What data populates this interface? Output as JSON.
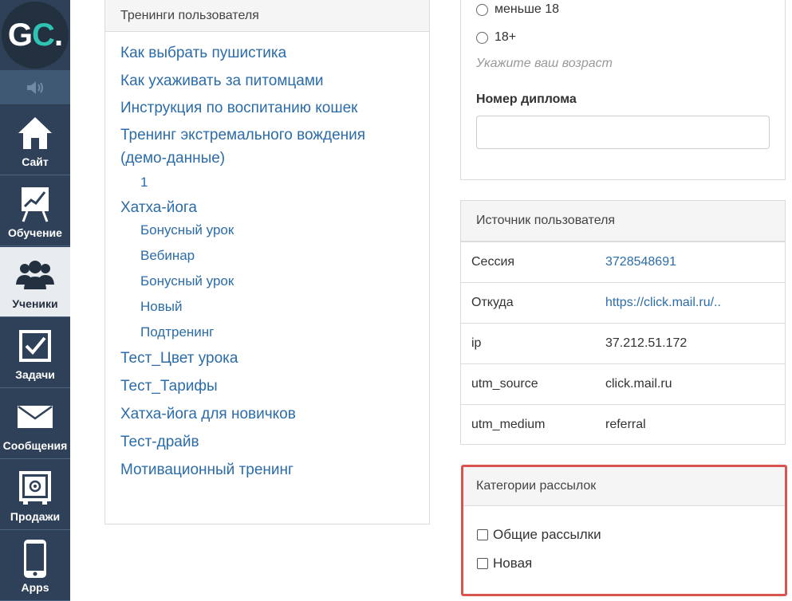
{
  "sidebar": {
    "logo": {
      "g": "G",
      "c": "C",
      "dot": "."
    },
    "items": [
      {
        "label": "Сайт",
        "icon": "home-icon"
      },
      {
        "label": "Обучение",
        "icon": "chart-board-icon"
      },
      {
        "label": "Ученики",
        "icon": "users-icon",
        "active": true
      },
      {
        "label": "Задачи",
        "icon": "checkbox-icon"
      },
      {
        "label": "Сообщения",
        "icon": "envelope-icon"
      },
      {
        "label": "Продажи",
        "icon": "safe-icon"
      },
      {
        "label": "Apps",
        "icon": "phone-icon"
      }
    ]
  },
  "trainings": {
    "header": "Тренинги пользователя",
    "items": [
      {
        "label": "Как выбрать пушистика",
        "level": 1
      },
      {
        "label": "Как ухаживать за питомцами",
        "level": 1
      },
      {
        "label": "Инструкция по воспитанию кошек",
        "level": 1
      },
      {
        "label": "Тренинг экстремального вождения (демо-данные)",
        "level": 1
      },
      {
        "label": "1",
        "level": 2
      },
      {
        "label": "Хатха-йога",
        "level": 1
      },
      {
        "label": "Бонусный урок",
        "level": 2
      },
      {
        "label": "Вебинар",
        "level": 2
      },
      {
        "label": "Бонусный урок",
        "level": 2
      },
      {
        "label": "Новый",
        "level": 2
      },
      {
        "label": "Подтренинг",
        "level": 2
      },
      {
        "label": "Тест_Цвет урока",
        "level": 1
      },
      {
        "label": "Тест_Тарифы",
        "level": 1
      },
      {
        "label": "Хатха-йога для новичков",
        "level": 1
      },
      {
        "label": "Тест-драйв",
        "level": 1
      },
      {
        "label": "Мотивационный тренинг",
        "level": 1
      }
    ]
  },
  "profile": {
    "age_options": [
      "меньше 18",
      "18+"
    ],
    "age_hint": "Укажите ваш возраст",
    "diploma_label": "Номер диплома",
    "diploma_value": ""
  },
  "source": {
    "header": "Источник пользователя",
    "rows": [
      {
        "key": "Сессия",
        "value": "3728548691",
        "link": true
      },
      {
        "key": "Откуда",
        "value": "https://click.mail.ru/..",
        "link": true
      },
      {
        "key": "ip",
        "value": "37.212.51.172",
        "link": false
      },
      {
        "key": "utm_source",
        "value": "click.mail.ru",
        "link": false
      },
      {
        "key": "utm_medium",
        "value": "referral",
        "link": false
      }
    ]
  },
  "mailing": {
    "header": "Категории рассылок",
    "options": [
      "Общие рассылки",
      "Новая"
    ],
    "highlight_color": "#d9534f"
  }
}
